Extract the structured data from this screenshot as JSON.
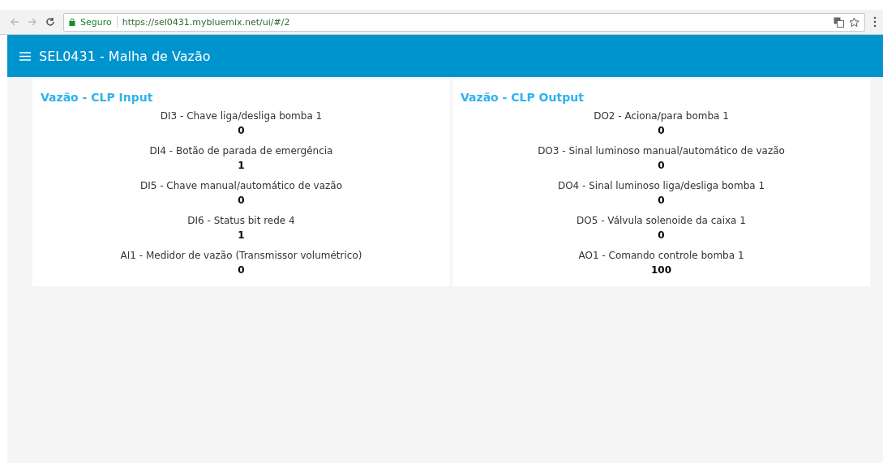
{
  "browser": {
    "secure_label": "Seguro",
    "url": "https://sel0431.mybluemix.net/ui/#/2"
  },
  "header": {
    "title": "SEL0431 - Malha de Vazão"
  },
  "groups": [
    {
      "title": "Vazão - CLP Input",
      "items": [
        {
          "label": "DI3 - Chave liga/desliga bomba 1",
          "value": "0"
        },
        {
          "label": "DI4 - Botão de parada de emergência",
          "value": "1"
        },
        {
          "label": "DI5 - Chave manual/automático de vazão",
          "value": "0"
        },
        {
          "label": "DI6 - Status bit rede 4",
          "value": "1"
        },
        {
          "label": "AI1 - Medidor de vazão (Transmissor volumétrico)",
          "value": "0"
        }
      ]
    },
    {
      "title": "Vazão - CLP Output",
      "items": [
        {
          "label": "DO2 - Aciona/para bomba 1",
          "value": "0"
        },
        {
          "label": "DO3 - Sinal luminoso manual/automático de vazão",
          "value": "0"
        },
        {
          "label": "DO4 - Sinal luminoso liga/desliga bomba 1",
          "value": "0"
        },
        {
          "label": "DO5 - Válvula solenoide da caixa 1",
          "value": "0"
        },
        {
          "label": "AO1 - Comando controle bomba 1",
          "value": "100"
        }
      ]
    }
  ]
}
